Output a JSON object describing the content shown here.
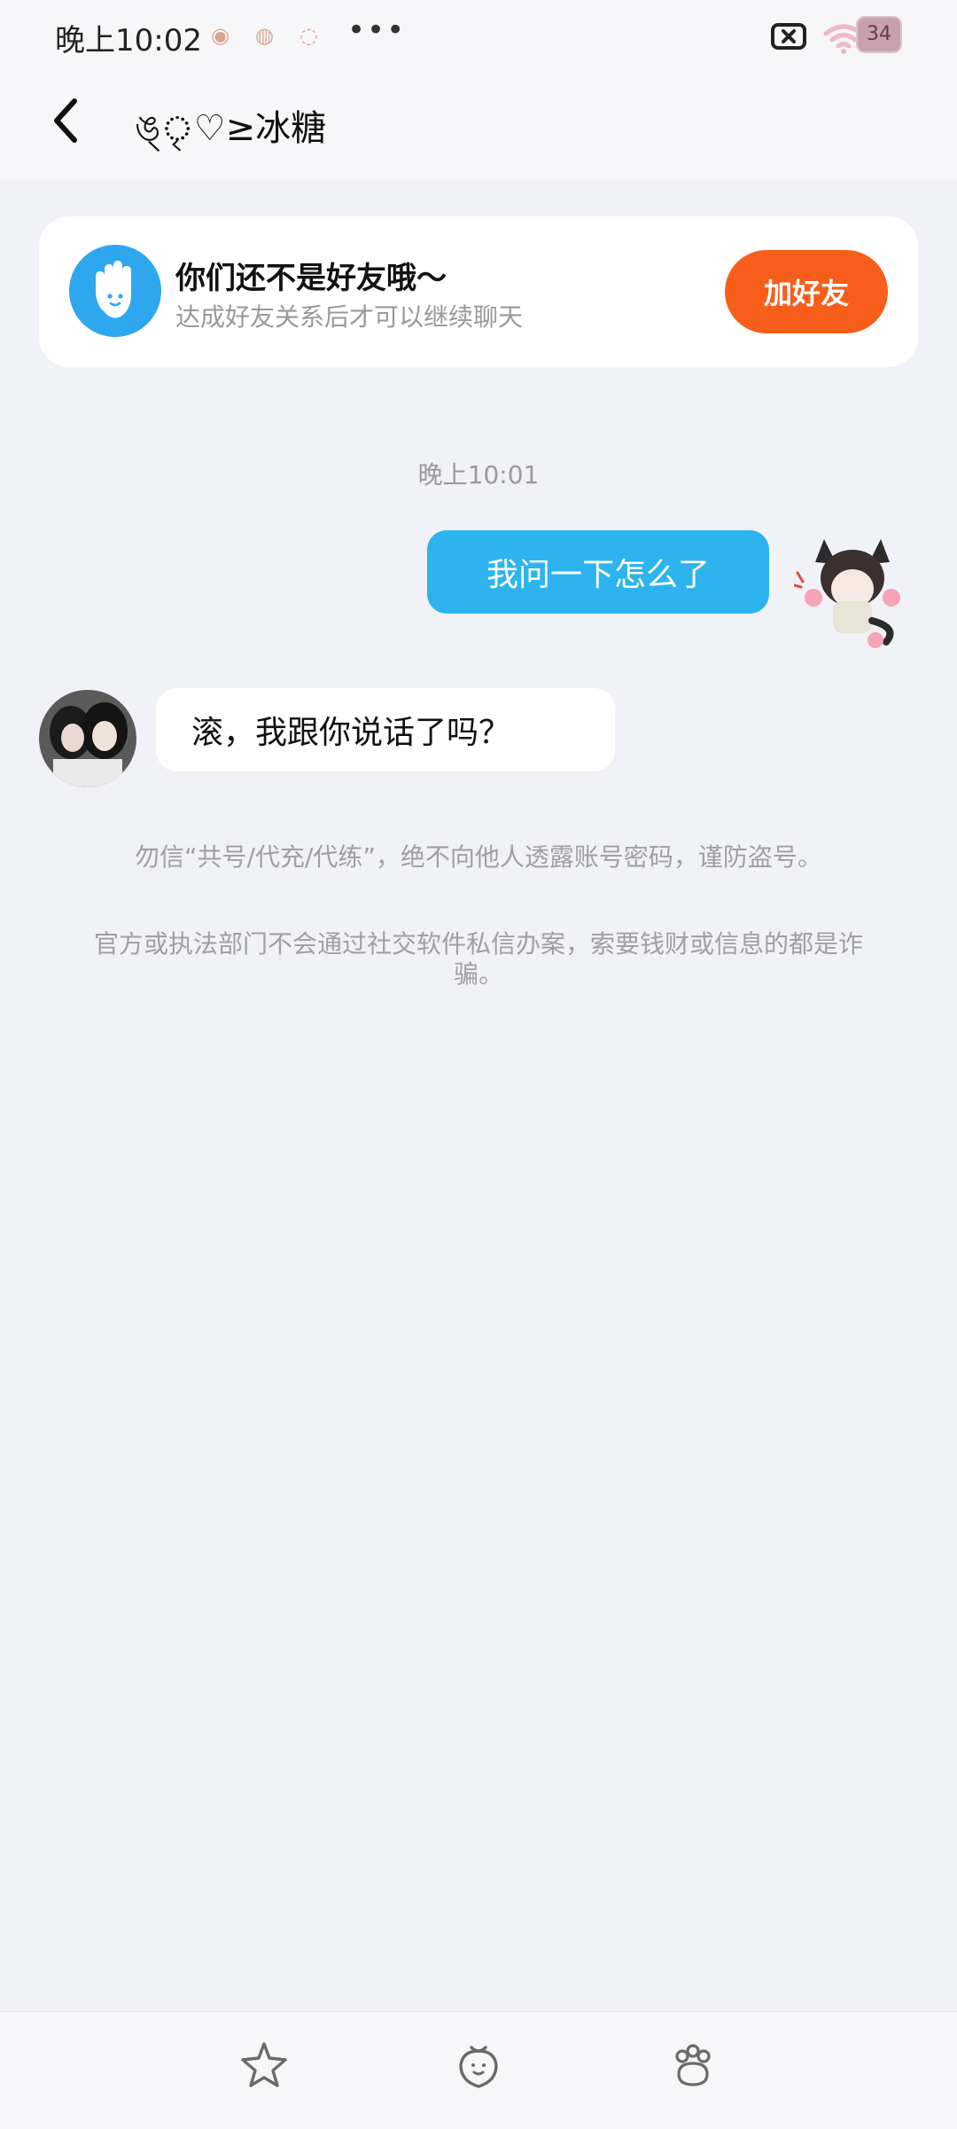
{
  "status_bar": {
    "time": "晚上10:02",
    "dots": "•••",
    "battery": "34"
  },
  "header": {
    "title": "ঙ্ৃ♡≥冰糖"
  },
  "friend_card": {
    "title": "你们还不是好友哦～",
    "subtitle": "达成好友关系后才可以继续聊天",
    "button_label": "加好友"
  },
  "messages": [
    {
      "type": "timestamp",
      "text": "晚上10:01"
    },
    {
      "type": "outgoing",
      "text": "我问一下怎么了"
    },
    {
      "type": "incoming",
      "text": "滚，我跟你说话了吗？"
    }
  ],
  "notices": [
    "勿信“共号/代充/代练”，绝不向他人透露账号密码，谨防盗号。",
    "官方或执法部门不会通过社交软件私信办案，索要钱财或信息的都是诈骗。"
  ],
  "icons": {
    "back": "back-arrow-icon",
    "hand": "hand-icon",
    "star": "star-icon",
    "strawberry": "strawberry-icon",
    "paw": "paw-icon"
  }
}
